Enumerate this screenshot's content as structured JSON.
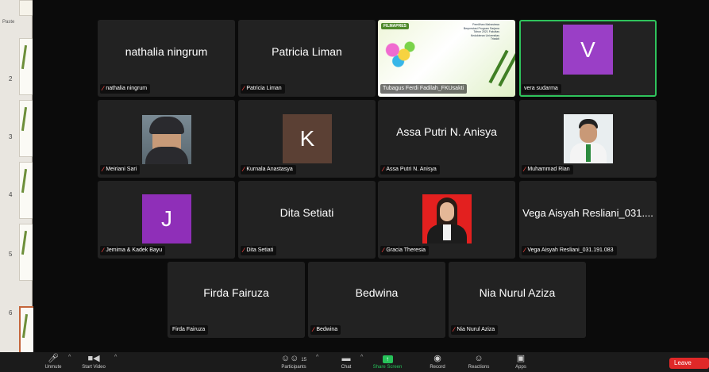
{
  "side_panel": {
    "paste_label": "Paste",
    "slide_numbers": [
      "2",
      "3",
      "4",
      "5",
      "6"
    ]
  },
  "tiles": [
    {
      "id": "nathalia",
      "display": "nathalia ningrum",
      "label": "nathalia ningrum"
    },
    {
      "id": "patricia",
      "display": "Patricia Liman",
      "label": "Patricia Liman"
    },
    {
      "id": "tubagus",
      "label": "Tubagus Ferdi Fadilah_FKUsakti",
      "slide": {
        "logo": "FILMAPRES",
        "heading": "Pemilihan Mahasiswa Berprestasi Program Sarjana Tahun 2021 Fakultas Kedokteran Universitas Trisakti"
      }
    },
    {
      "id": "vera",
      "avatar_letter": "V",
      "label": "vera sudarma",
      "avatar_color": "#9a3fc6"
    },
    {
      "id": "meiriani",
      "label": "Meiriani Sari"
    },
    {
      "id": "kurnala",
      "avatar_letter": "K",
      "label": "Kurnala Anastasya",
      "avatar_color": "#5b4034"
    },
    {
      "id": "assa",
      "display": "Assa Putri N. Anisya",
      "label": "Assa Putri N. Anisya"
    },
    {
      "id": "rian",
      "label": "Muhammad Rian"
    },
    {
      "id": "jemima",
      "avatar_letter": "J",
      "label": "Jemima & Kadek Bayu",
      "avatar_color": "#8f2fb8"
    },
    {
      "id": "dita",
      "display": "Dita Setiati",
      "label": "Dita Setiati"
    },
    {
      "id": "gracia",
      "label": "Gracia Theresia"
    },
    {
      "id": "vega",
      "display": "Vega Aisyah Resliani_031....",
      "label": "Vega Aisyah Resliani_031.191.083"
    },
    {
      "id": "firda",
      "display": "Firda Fairuza",
      "label": "Firda Fairuza"
    },
    {
      "id": "bedwina",
      "display": "Bedwina",
      "label": "Bedwina"
    },
    {
      "id": "nia",
      "display": "Nia Nurul Aziza",
      "label": "Nia Nurul Aziza"
    }
  ],
  "toolbar": {
    "unmute": "Unmute",
    "start_video": "Start Video",
    "participants": "Participants",
    "participant_count": "15",
    "chat": "Chat",
    "share_screen": "Share Screen",
    "record": "Record",
    "reactions": "Reactions",
    "apps": "Apps",
    "leave": "Leave"
  },
  "colors": {
    "active_speaker_border": "#2fc35c",
    "muted_mic": "#e8403b",
    "share_green": "#26c259",
    "leave_red": "#e02828"
  }
}
